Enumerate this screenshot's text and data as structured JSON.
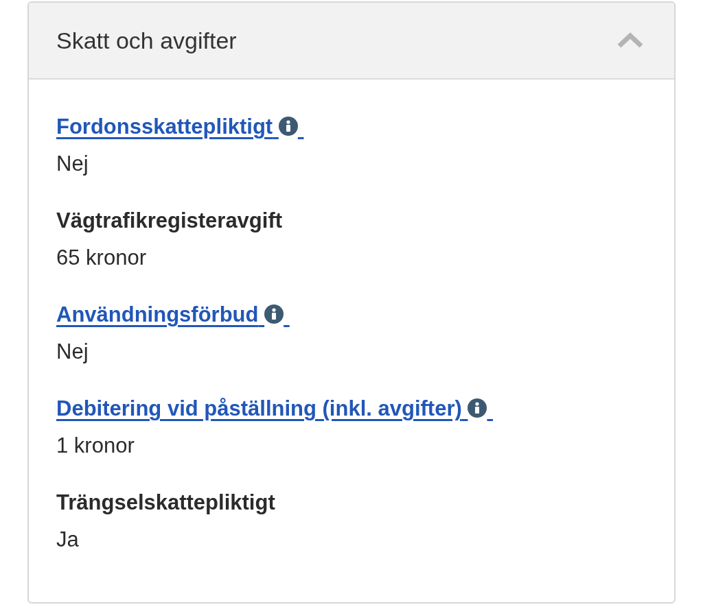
{
  "panel": {
    "title": "Skatt och avgifter",
    "expanded": true,
    "items": [
      {
        "kind": "link",
        "label": "Fordonsskattepliktigt",
        "value": "Nej"
      },
      {
        "kind": "plain",
        "label": "Vägtrafikregisteravgift",
        "value": "65 kronor"
      },
      {
        "kind": "link",
        "label": "Användningsförbud",
        "value": "Nej"
      },
      {
        "kind": "link",
        "label": "Debitering vid påställning (inkl. avgifter)",
        "value": "1 kronor"
      },
      {
        "kind": "plain",
        "label": "Trängselskattepliktigt",
        "value": "Ja"
      }
    ]
  }
}
